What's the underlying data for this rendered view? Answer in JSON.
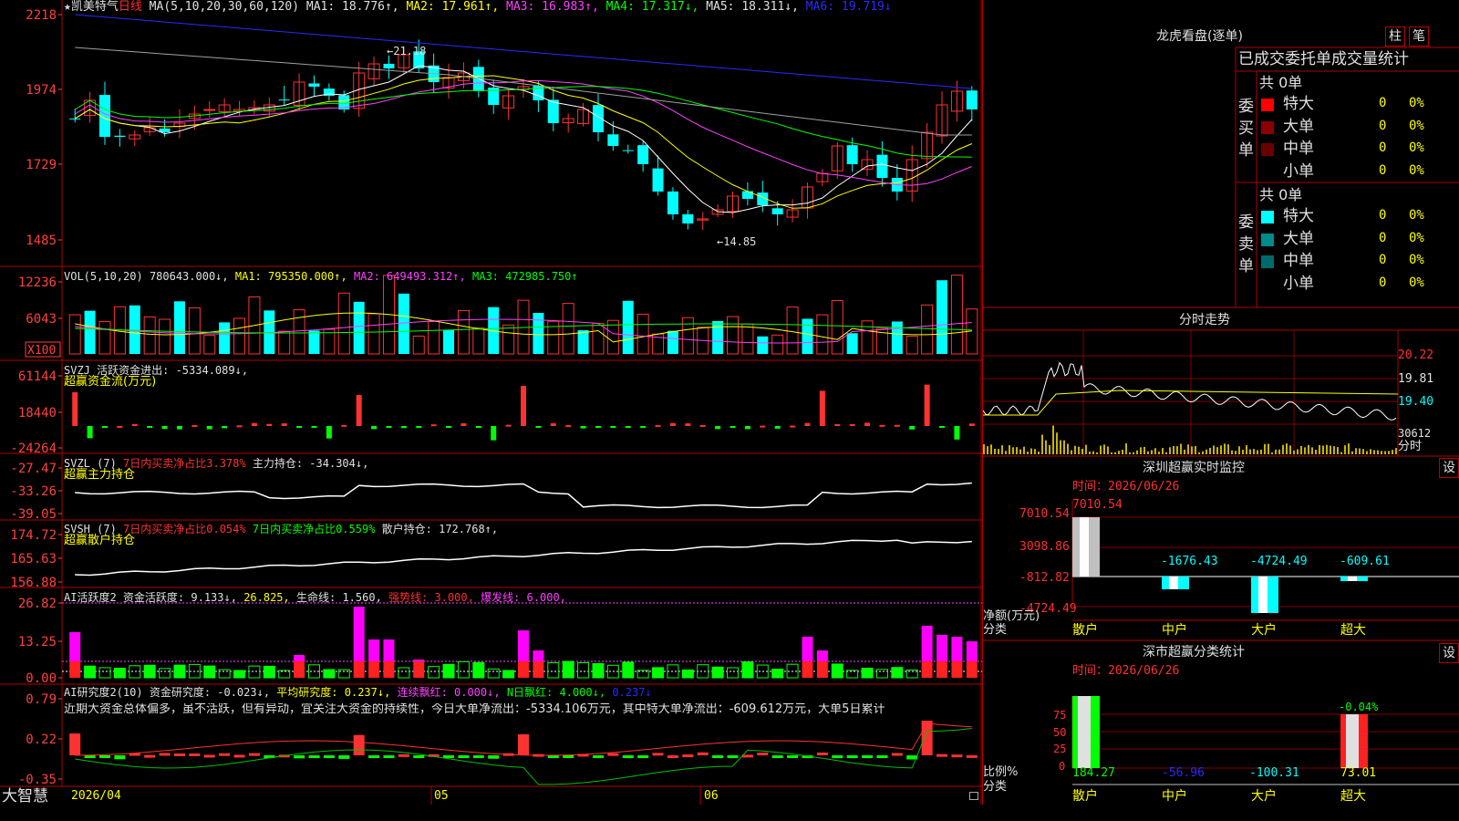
{
  "colors": {
    "up": "#ff3232",
    "down": "#00ffff",
    "vol_up": "#ff3232",
    "vol_down": "#00ffff",
    "ma1": "#ffffff",
    "ma2": "#ffff00",
    "ma3": "#ff40ff",
    "ma4": "#00ff00",
    "ma5": "#a0a0a0",
    "ma6": "#2a2aff",
    "grid": "#b00000",
    "axis_text": "#ff4040"
  },
  "main_chart": {
    "name": "★凯美特气",
    "period": "日线",
    "ma_def": "MA(5,10,20,30,60,120)",
    "ma1": "MA1: 18.776↑,",
    "ma2": "MA2: 17.961↑,",
    "ma3": "MA3: 16.983↑,",
    "ma4": "MA4: 17.317↓,",
    "ma5": "MA5: 18.311↓,",
    "ma6": "MA6: 19.719↓",
    "y_ticks": [
      "2218",
      "1974",
      "1729",
      "1485"
    ],
    "high_mark": "←21.18",
    "low_mark": "←14.85"
  },
  "vol_chart": {
    "def": "VOL(5,10,20)",
    "vol": "780643.000↓,",
    "ma1": "MA1: 795350.000↑,",
    "ma2": "MA2: 649493.312↑,",
    "ma3": "MA3: 472985.750↑",
    "y_ticks": [
      "12236",
      "6043"
    ],
    "unit": "X100"
  },
  "svzj": {
    "title": "SVZJ  活跃资金进出: -5334.089↓,",
    "subtitle": "超赢资金流(万元)",
    "y_ticks": [
      "61144",
      "18440",
      "-24264"
    ]
  },
  "svzl": {
    "title": "SVZL (7)",
    "t1": "7日内买卖净占比3.378%",
    "t2": "主力持仓: -34.304↓,",
    "subtitle": "超赢主力持仓",
    "y_ticks": [
      "-27.47",
      "-33.26",
      "-39.05"
    ]
  },
  "svsh": {
    "title": "SVSH (7)",
    "t1": "7日内买卖净占比0.054%",
    "t2": "7日内买卖净占比0.559%",
    "t3": "散户持仓: 172.768↑,",
    "subtitle": "超赢散户持仓",
    "y_ticks": [
      "174.72",
      "165.63",
      "156.88"
    ]
  },
  "ai_active": {
    "t0": "AI活跃度2",
    "t1": "资金活跃度: 9.133↓,",
    "t2": "26.825,",
    "t3": "生命线: 1.560,",
    "t4": "强势线: 3.000,",
    "t5": "爆发线: 6.000,",
    "y_ticks": [
      "26.82",
      "13.25",
      "0.00"
    ]
  },
  "ai_research": {
    "t0": "AI研究度2(10)",
    "t1": "资金研究度: -0.023↓,",
    "t2": "平均研究度: 0.237↓,",
    "t3": "连续飘红: 0.000↓,",
    "t4": "N日飘红: 4.000↓,",
    "t5": "0.237↓",
    "note": "近期大资金总体偏多，虽不活跃，但有异动，宜关注大资金的持续性，今日大单净流出：-5334.106万元，其中特大单净流出：-609.612万元，大单5日累计",
    "y_ticks": [
      "0.79",
      "0.22",
      "-0.35"
    ]
  },
  "x_axis": {
    "labels": [
      "2026/04",
      "05",
      "06"
    ]
  },
  "brand": "大智慧",
  "right": {
    "lhb_title": "龙虎看盘(逐单)",
    "btn1": "柱",
    "btn2": "笔",
    "header": "已成交委托单成交量统计",
    "buy_label": "委买单",
    "sell_label": "委卖单",
    "buy_total": "共 0单",
    "sell_total": "共 0单",
    "buy_rows": [
      {
        "name": "特大",
        "n": "0",
        "p": "0%"
      },
      {
        "name": "大单",
        "n": "0",
        "p": "0%"
      },
      {
        "name": "中单",
        "n": "0",
        "p": "0%"
      },
      {
        "name": "小单",
        "n": "0",
        "p": "0%"
      }
    ],
    "sell_rows": [
      {
        "name": "特大",
        "n": "0",
        "p": "0%"
      },
      {
        "name": "大单",
        "n": "0",
        "p": "0%"
      },
      {
        "name": "中单",
        "n": "0",
        "p": "0%"
      },
      {
        "name": "小单",
        "n": "0",
        "p": "0%"
      }
    ],
    "buy_colors": [
      "#ff0000",
      "#8b0000",
      "#6a0000",
      "#000000"
    ],
    "sell_colors": [
      "#00ffff",
      "#008b8b",
      "#006a6a",
      "#000000"
    ],
    "intraday_title": "分时走势",
    "intraday_y": [
      "20.22",
      "19.81",
      "19.40",
      "30612"
    ],
    "intraday_unit": "分时",
    "sz_monitor_title": "深圳超赢实时监控",
    "set": "设",
    "sz_time": "时间：2026/06/26",
    "sz_y": [
      "7010.54",
      "3098.86",
      "-812.82",
      "-4724.49"
    ],
    "sz_ylabel": "净额(万元)",
    "sz_cat_label": "分类",
    "sz_values": [
      {
        "cat": "散户",
        "v": "7010.54"
      },
      {
        "cat": "中户",
        "v": "-1676.43"
      },
      {
        "cat": "大户",
        "v": "-4724.49"
      },
      {
        "cat": "超大",
        "v": "-609.61"
      }
    ],
    "sz_class_title": "深市超赢分类统计",
    "sz_class_time": "时间：2026/06/26",
    "cls_y": [
      "75",
      "50",
      "25",
      "0"
    ],
    "cls_ylabel": "比例%",
    "cls_cat_label": "分类",
    "cls_top": "-0.04%",
    "cls_values": [
      {
        "cat": "散户",
        "v": "184.27"
      },
      {
        "cat": "中户",
        "v": "-56.96"
      },
      {
        "cat": "大户",
        "v": "-100.31"
      },
      {
        "cat": "超大",
        "v": "73.01"
      }
    ]
  }
}
